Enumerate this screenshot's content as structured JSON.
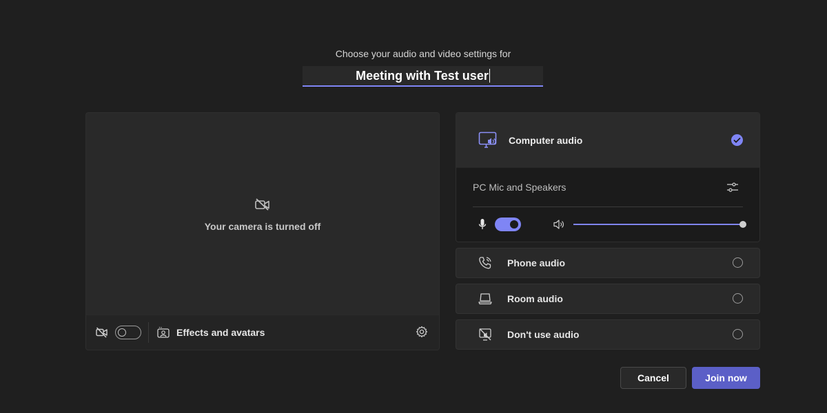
{
  "header": {
    "subtitle": "Choose your audio and video settings for",
    "meeting_title": "Meeting with Test user"
  },
  "video": {
    "camera_off_text": "Your camera is turned off",
    "camera_toggle_on": false,
    "effects_label": "Effects and avatars"
  },
  "audio": {
    "selected": {
      "label": "Computer audio",
      "device": "PC Mic and Speakers",
      "mic_toggle_on": true,
      "volume_level": 1.0
    },
    "options": [
      {
        "label": "Phone audio",
        "icon": "phone-icon"
      },
      {
        "label": "Room audio",
        "icon": "room-icon"
      },
      {
        "label": "Don't use audio",
        "icon": "no-audio-icon"
      }
    ]
  },
  "buttons": {
    "cancel": "Cancel",
    "join": "Join now"
  },
  "colors": {
    "accent": "#7f85f5",
    "primary_button": "#5b5fc7",
    "background": "#1f1f1f"
  }
}
